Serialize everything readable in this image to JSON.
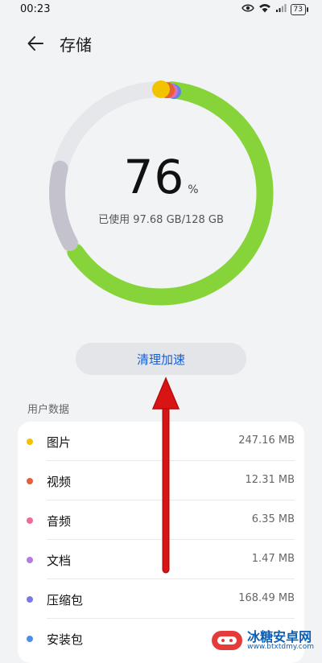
{
  "status_bar": {
    "time": "00:23",
    "battery": "73"
  },
  "header": {
    "title": "存储"
  },
  "storage": {
    "used_fraction": 0.76,
    "percent": "76",
    "percent_sign": "%",
    "usage_text": "已使用 97.68 GB/128 GB"
  },
  "actions": {
    "clean_label": "清理加速"
  },
  "section": {
    "title": "用户数据"
  },
  "items": [
    {
      "name": "图片",
      "size": "247.16 MB",
      "color": "#f2c300"
    },
    {
      "name": "视频",
      "size": "12.31 MB",
      "color": "#e5603a"
    },
    {
      "name": "音频",
      "size": "6.35 MB",
      "color": "#f06a9c"
    },
    {
      "name": "文档",
      "size": "1.47 MB",
      "color": "#b57ce0"
    },
    {
      "name": "压缩包",
      "size": "168.49 MB",
      "color": "#7b78e6"
    },
    {
      "name": "安装包",
      "size": "",
      "color": "#4f8ee8"
    }
  ],
  "watermark": {
    "brand": "冰糖安卓网",
    "url": "www.btxtdmy.com"
  },
  "colors": {
    "ring_green": "#86d43a",
    "ring_track": "#e6e7ea",
    "ring_gray": "#c4c3cd",
    "accent_blue": "#1b5fd1",
    "arrow_red": "#d91414"
  }
}
